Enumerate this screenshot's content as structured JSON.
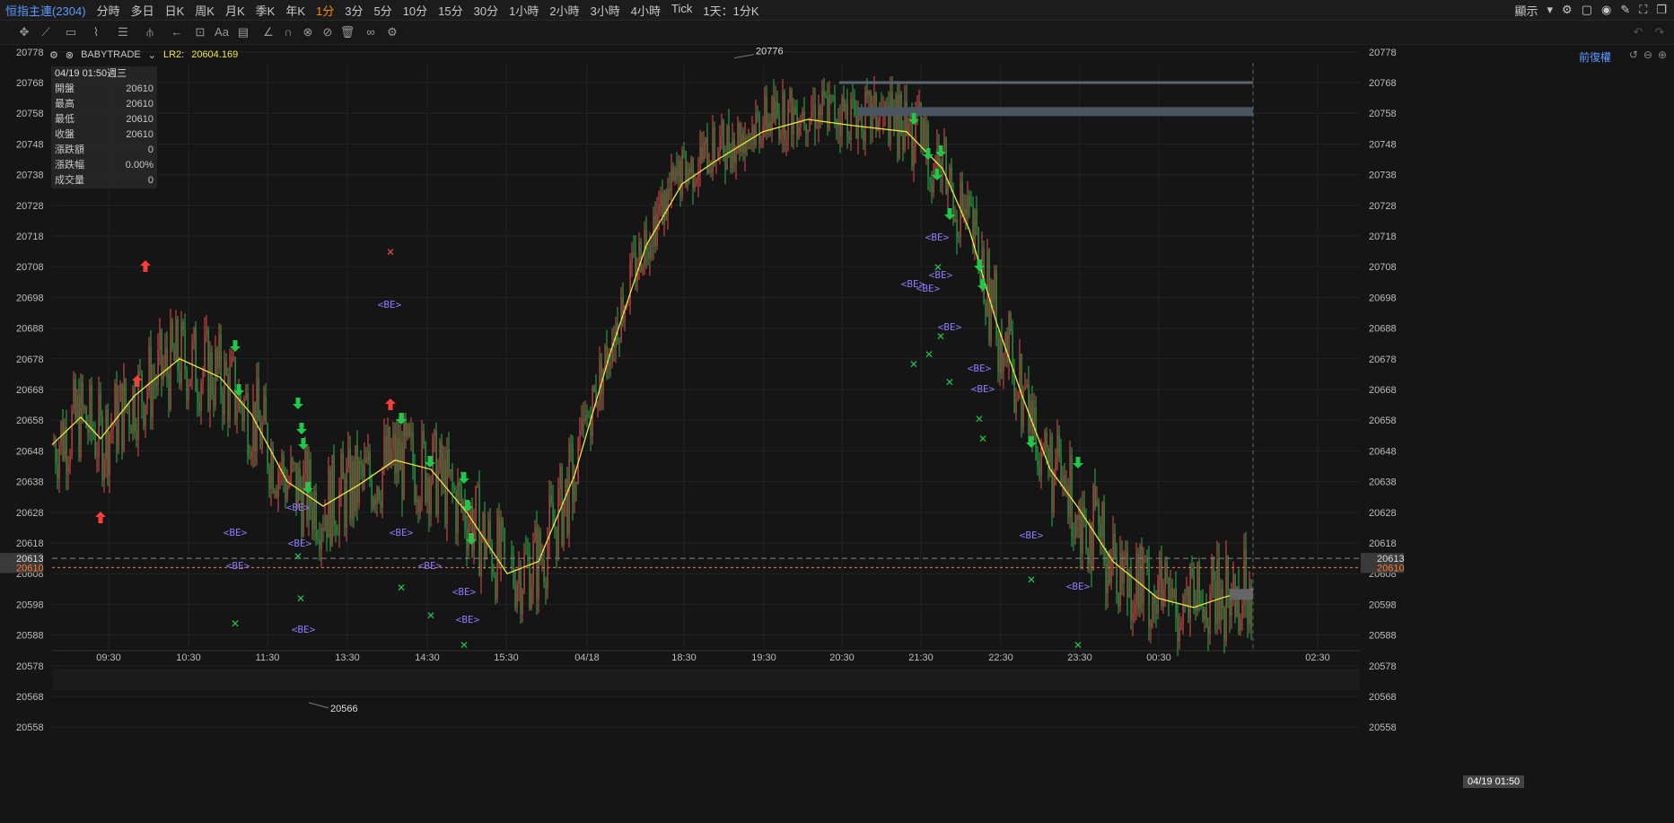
{
  "topbar": {
    "symbol": "恒指主連(2304)",
    "timeframes": [
      "分時",
      "多日",
      "日K",
      "周K",
      "月K",
      "季K",
      "年K",
      "1分",
      "3分",
      "5分",
      "10分",
      "15分",
      "30分",
      "1小時",
      "2小時",
      "3小時",
      "4小時",
      "Tick",
      "1天：1分K"
    ],
    "active_timeframe": "1分",
    "display_label": "顯示"
  },
  "legend": {
    "indicator": "BABYTRADE",
    "lr2_label": "LR2:",
    "lr2_value": "20604.169",
    "restore_label": "前復權"
  },
  "infobox": {
    "datetime": "04/19 01:50週三",
    "rows": [
      {
        "label": "開盤",
        "value": "20610"
      },
      {
        "label": "最高",
        "value": "20610"
      },
      {
        "label": "最低",
        "value": "20610"
      },
      {
        "label": "收盤",
        "value": "20610"
      },
      {
        "label": "漲跌額",
        "value": "0"
      },
      {
        "label": "漲跌幅",
        "value": "0.00%"
      },
      {
        "label": "成交量",
        "value": "0"
      }
    ]
  },
  "price_axis": [
    "20778",
    "20768",
    "20758",
    "20748",
    "20738",
    "20728",
    "20718",
    "20708",
    "20698",
    "20688",
    "20678",
    "20668",
    "20658",
    "20648",
    "20638",
    "20628",
    "20618",
    "20608",
    "20598",
    "20588",
    "20578",
    "20568",
    "20558"
  ],
  "time_axis": [
    "09:30",
    "10:30",
    "11:30",
    "13:30",
    "14:30",
    "15:30",
    "04/18",
    "18:30",
    "19:30",
    "20:30",
    "21:30",
    "22:30",
    "23:30",
    "00:30",
    "01:50",
    "02:30"
  ],
  "crosshair_time": "04/19 01:50",
  "price_tags": {
    "crosshair_price": "20613",
    "last_price": "20610"
  },
  "annotations": {
    "high_label": "20776",
    "low_label": "20566",
    "be_label": "<BE>"
  },
  "colors": {
    "up": "#e84b4b",
    "down": "#25b34a",
    "ma": "#f0e640",
    "signal_up": "#ff3b3b",
    "signal_down": "#1ec94a",
    "be": "#8a7cff",
    "last_price": "#ff7b2e"
  },
  "icons": [
    "cursor-move-icon",
    "line-tool-icon",
    "rect-tool-icon",
    "path-tool-icon",
    "fib-tool-icon",
    "pitchfork-icon",
    "arrow-tool-icon",
    "text-tool-icon",
    "comment-icon",
    "ruler-icon",
    "magnet-icon",
    "lock-icon",
    "hide-icon",
    "trash-icon",
    "settings-icon",
    "camera-icon",
    "pencil-icon",
    "fullscreen-icon"
  ]
}
